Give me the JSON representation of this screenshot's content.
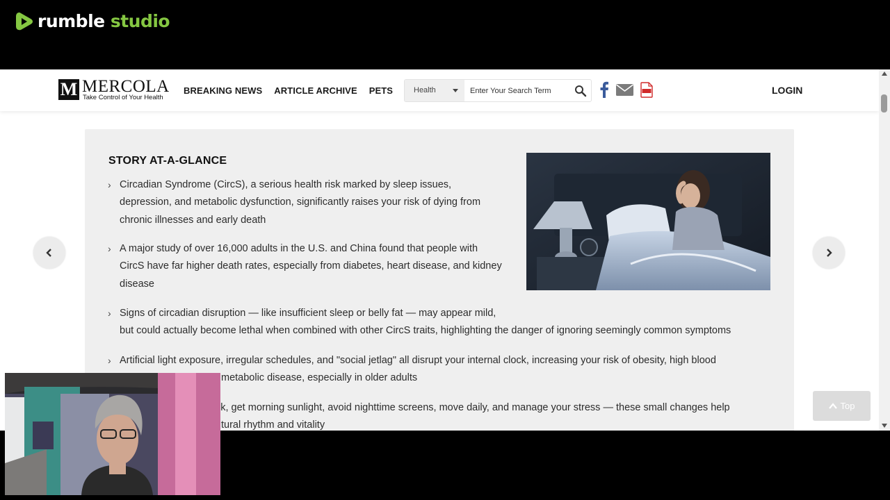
{
  "rumble": {
    "word1": "rumble",
    "word2": "studio",
    "accent_color": "#85c742"
  },
  "site": {
    "logo": {
      "letter": "M",
      "name": "MERCOLA",
      "tagline": "Take Control of Your Health"
    },
    "nav": [
      {
        "label": "BREAKING NEWS"
      },
      {
        "label": "ARTICLE ARCHIVE"
      },
      {
        "label": "PETS"
      }
    ],
    "search": {
      "category": "Health",
      "placeholder": "Enter Your Search Term"
    },
    "social_icons": [
      "facebook-icon",
      "mail-icon",
      "pdf-icon"
    ],
    "login_label": "LOGIN"
  },
  "story": {
    "title": "STORY AT-A-GLANCE",
    "bullets": [
      {
        "lines": [
          "Circadian Syndrome (CircS), a serious health risk marked by sleep issues,",
          "depression, and metabolic dysfunction, significantly raises your risk of dying from",
          "chronic illnesses and early death"
        ]
      },
      {
        "lines": [
          "A major study of over 16,000 adults in the U.S. and China found that people with",
          "CircS have far higher death rates, especially from diabetes, heart disease, and kidney",
          "disease"
        ]
      },
      {
        "lines": [
          "Signs of circadian disruption — like insufficient sleep or belly fat — may appear mild,",
          "but could actually become lethal when combined with other CircS traits, highlighting the danger of ignoring seemingly common symptoms"
        ]
      },
      {
        "lines": [
          "Artificial light exposure, irregular schedules, and \"social jetlag\" all disrupt your internal clock, increasing your risk of obesity, high blood",
          "metabolic disease, especially in older adults"
        ]
      },
      {
        "lines": [
          "ck, get morning sunlight, avoid nighttime screens, move daily, and manage your stress — these small changes help",
          "tural rhythm and vitality"
        ]
      }
    ]
  },
  "controls": {
    "top_label": "Top"
  }
}
